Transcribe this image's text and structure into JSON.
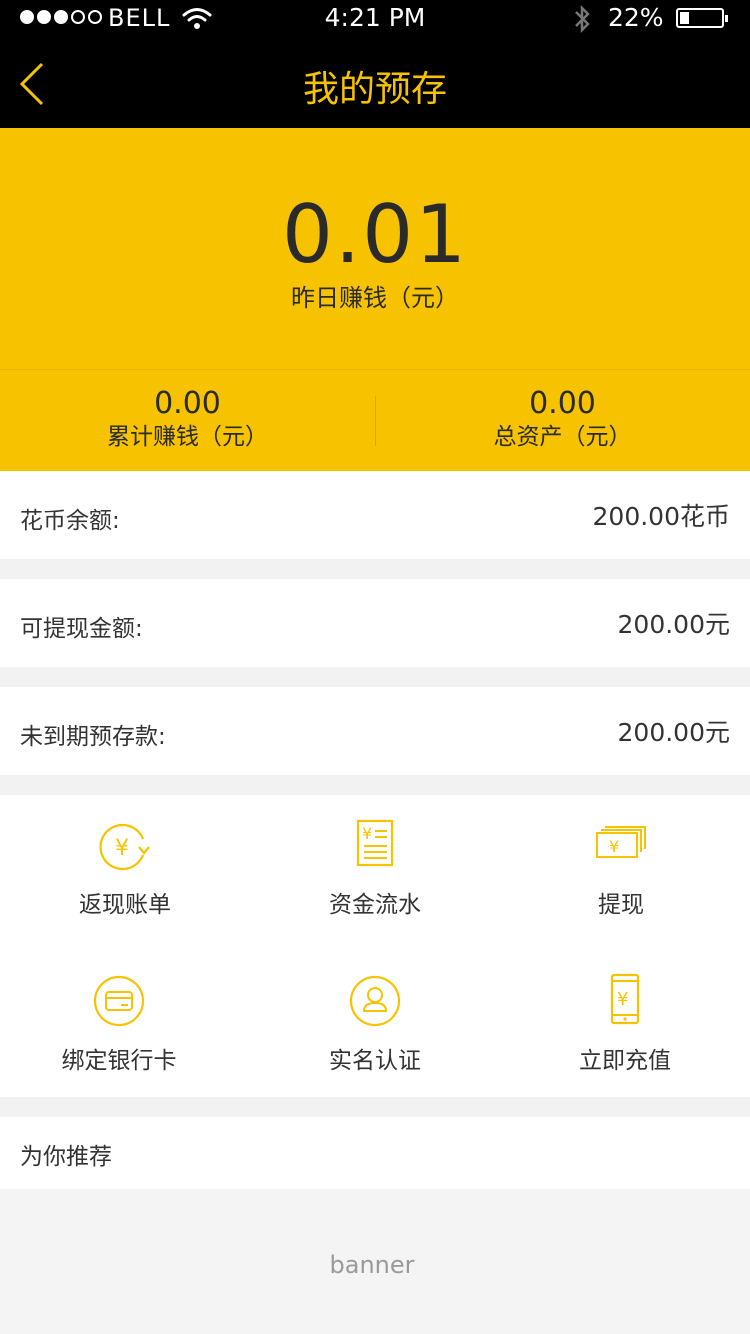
{
  "status_bar": {
    "carrier": "BELL",
    "time": "4:21 PM",
    "battery_percent": "22%",
    "battery_level": 0.22,
    "signal_bars_filled": 3,
    "signal_bars_total": 5
  },
  "nav": {
    "title": "我的预存",
    "back_icon": "chevron-left-icon"
  },
  "summary": {
    "yesterday_value": "0.01",
    "yesterday_label": "昨日赚钱（元）",
    "total_earned_value": "0.00",
    "total_earned_label": "累计赚钱（元）",
    "total_assets_value": "0.00",
    "total_assets_label": "总资产（元）"
  },
  "balances": [
    {
      "label": "花币余额:",
      "value": "200.00花币"
    },
    {
      "label": "可提现金额:",
      "value": "200.00元"
    },
    {
      "label": "未到期预存款:",
      "value": "200.00元"
    }
  ],
  "actions": [
    {
      "label": "返现账单",
      "icon": "cashback-icon"
    },
    {
      "label": "资金流水",
      "icon": "ledger-icon"
    },
    {
      "label": "提现",
      "icon": "withdraw-cash-icon"
    },
    {
      "label": "绑定银行卡",
      "icon": "bank-card-icon"
    },
    {
      "label": "实名认证",
      "icon": "user-verify-icon"
    },
    {
      "label": "立即充值",
      "icon": "phone-recharge-icon"
    }
  ],
  "recommend": {
    "title": "为你推荐",
    "banner_text": "banner"
  },
  "colors": {
    "accent": "#f7c300",
    "nav_background": "#000000",
    "page_background": "#f2f2f2"
  }
}
